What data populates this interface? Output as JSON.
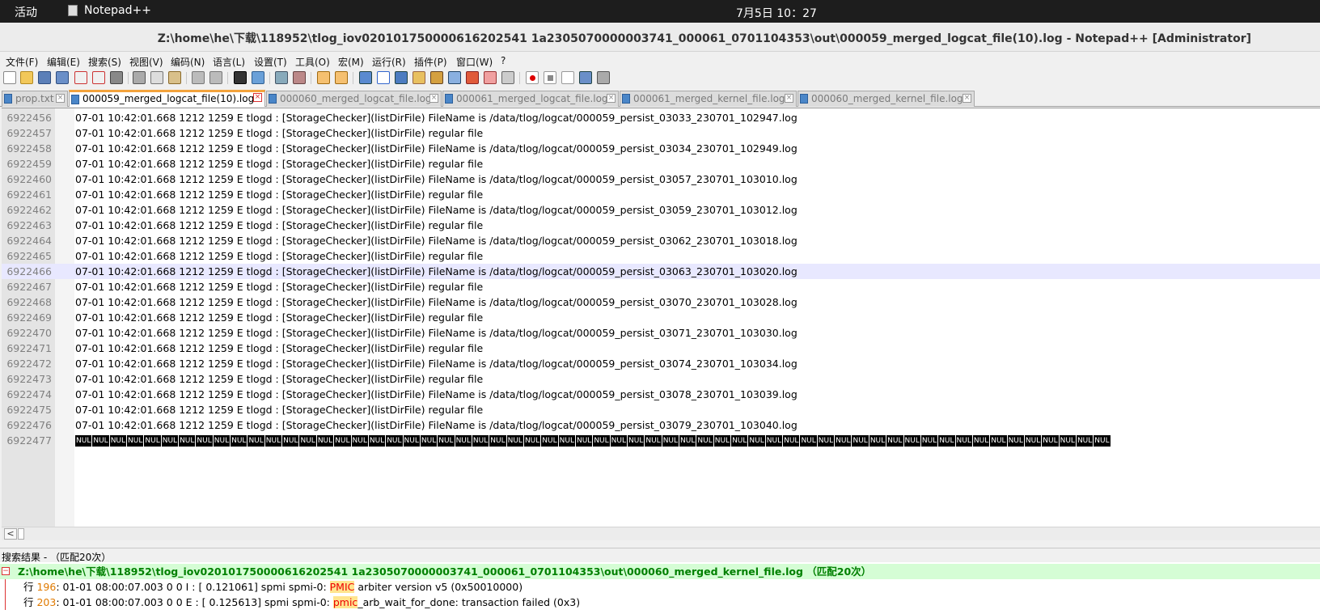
{
  "topbar": {
    "activities": "活动",
    "app_name": "Notepad++",
    "clock": "7月5日  10：27"
  },
  "window": {
    "title": "Z:\\home\\he\\下载\\118952\\tlog_iov020101750000616202541 1a2305070000003741_000061_0701104353\\out\\000059_merged_logcat_file(10).log - Notepad++ [Administrator]"
  },
  "menu": {
    "items": [
      "文件(F)",
      "编辑(E)",
      "搜索(S)",
      "视图(V)",
      "编码(N)",
      "语言(L)",
      "设置(T)",
      "工具(O)",
      "宏(M)",
      "运行(R)",
      "插件(P)",
      "窗口(W)",
      "?"
    ]
  },
  "tabs": [
    {
      "label": "prop.txt",
      "active": false
    },
    {
      "label": "000059_merged_logcat_file(10).log",
      "active": true
    },
    {
      "label": "000060_merged_logcat_file.log",
      "active": false
    },
    {
      "label": "000061_merged_logcat_file.log",
      "active": false
    },
    {
      "label": "000061_merged_kernel_file.log",
      "active": false
    },
    {
      "label": "000060_merged_kernel_file.log",
      "active": false
    }
  ],
  "editor": {
    "current_line": 6922466,
    "lines": [
      {
        "n": "6922456",
        "text": "07-01 10:42:01.668  1212  1259 E tlogd   : [StorageChecker](listDirFile) FileName is /data/tlog/logcat/000059_persist_03033_230701_102947.log"
      },
      {
        "n": "6922457",
        "text": "07-01 10:42:01.668  1212  1259 E tlogd   : [StorageChecker](listDirFile) regular file"
      },
      {
        "n": "6922458",
        "text": "07-01 10:42:01.668  1212  1259 E tlogd   : [StorageChecker](listDirFile) FileName is /data/tlog/logcat/000059_persist_03034_230701_102949.log"
      },
      {
        "n": "6922459",
        "text": "07-01 10:42:01.668  1212  1259 E tlogd   : [StorageChecker](listDirFile) regular file"
      },
      {
        "n": "6922460",
        "text": "07-01 10:42:01.668  1212  1259 E tlogd   : [StorageChecker](listDirFile) FileName is /data/tlog/logcat/000059_persist_03057_230701_103010.log"
      },
      {
        "n": "6922461",
        "text": "07-01 10:42:01.668  1212  1259 E tlogd   : [StorageChecker](listDirFile) regular file"
      },
      {
        "n": "6922462",
        "text": "07-01 10:42:01.668  1212  1259 E tlogd   : [StorageChecker](listDirFile) FileName is /data/tlog/logcat/000059_persist_03059_230701_103012.log"
      },
      {
        "n": "6922463",
        "text": "07-01 10:42:01.668  1212  1259 E tlogd   : [StorageChecker](listDirFile) regular file"
      },
      {
        "n": "6922464",
        "text": "07-01 10:42:01.668  1212  1259 E tlogd   : [StorageChecker](listDirFile) FileName is /data/tlog/logcat/000059_persist_03062_230701_103018.log"
      },
      {
        "n": "6922465",
        "text": "07-01 10:42:01.668  1212  1259 E tlogd   : [StorageChecker](listDirFile) regular file"
      },
      {
        "n": "6922466",
        "text": "07-01 10:42:01.668  1212  1259 E tlogd   : [StorageChecker](listDirFile) FileName is /data/tlog/logcat/000059_persist_03063_230701_103020.log"
      },
      {
        "n": "6922467",
        "text": "07-01 10:42:01.668  1212  1259 E tlogd   : [StorageChecker](listDirFile) regular file"
      },
      {
        "n": "6922468",
        "text": "07-01 10:42:01.668  1212  1259 E tlogd   : [StorageChecker](listDirFile) FileName is /data/tlog/logcat/000059_persist_03070_230701_103028.log"
      },
      {
        "n": "6922469",
        "text": "07-01 10:42:01.668  1212  1259 E tlogd   : [StorageChecker](listDirFile) regular file"
      },
      {
        "n": "6922470",
        "text": "07-01 10:42:01.668  1212  1259 E tlogd   : [StorageChecker](listDirFile) FileName is /data/tlog/logcat/000059_persist_03071_230701_103030.log"
      },
      {
        "n": "6922471",
        "text": "07-01 10:42:01.668  1212  1259 E tlogd   : [StorageChecker](listDirFile) regular file"
      },
      {
        "n": "6922472",
        "text": "07-01 10:42:01.668  1212  1259 E tlogd   : [StorageChecker](listDirFile) FileName is /data/tlog/logcat/000059_persist_03074_230701_103034.log"
      },
      {
        "n": "6922473",
        "text": "07-01 10:42:01.668  1212  1259 E tlogd   : [StorageChecker](listDirFile) regular file"
      },
      {
        "n": "6922474",
        "text": "07-01 10:42:01.668  1212  1259 E tlogd   : [StorageChecker](listDirFile) FileName is /data/tlog/logcat/000059_persist_03078_230701_103039.log"
      },
      {
        "n": "6922475",
        "text": "07-01 10:42:01.668  1212  1259 E tlogd   : [StorageChecker](listDirFile) regular file"
      },
      {
        "n": "6922476",
        "text": "07-01 10:42:01.668  1212  1259 E tlogd   : [StorageChecker](listDirFile) FileName is /data/tlog/logcat/000059_persist_03079_230701_103040.log"
      }
    ],
    "nul_line": {
      "n": "6922477",
      "token": "NUL"
    }
  },
  "search": {
    "header": "搜索结果 - （匹配20次）",
    "file_line": "Z:\\home\\he\\下载\\118952\\tlog_iov020101750000616202541 1a2305070000003741_000061_0701104353\\out\\000060_merged_kernel_file.log （匹配20次）",
    "results": [
      {
        "prefix": "行 ",
        "num": "196",
        "pre": ": 01-01 08:00:07.003     0     0 I       : [    0.121061] spmi spmi-0: ",
        "match": "PMIC",
        "post": " arbiter version v5 (0x50010000)"
      },
      {
        "prefix": "行 ",
        "num": "203",
        "pre": ": 01-01 08:00:07.003     0     0 E       : [    0.125613] spmi spmi-0: ",
        "match": "pmic",
        "post": "_arb_wait_for_done: transaction failed (0x3)"
      }
    ]
  }
}
